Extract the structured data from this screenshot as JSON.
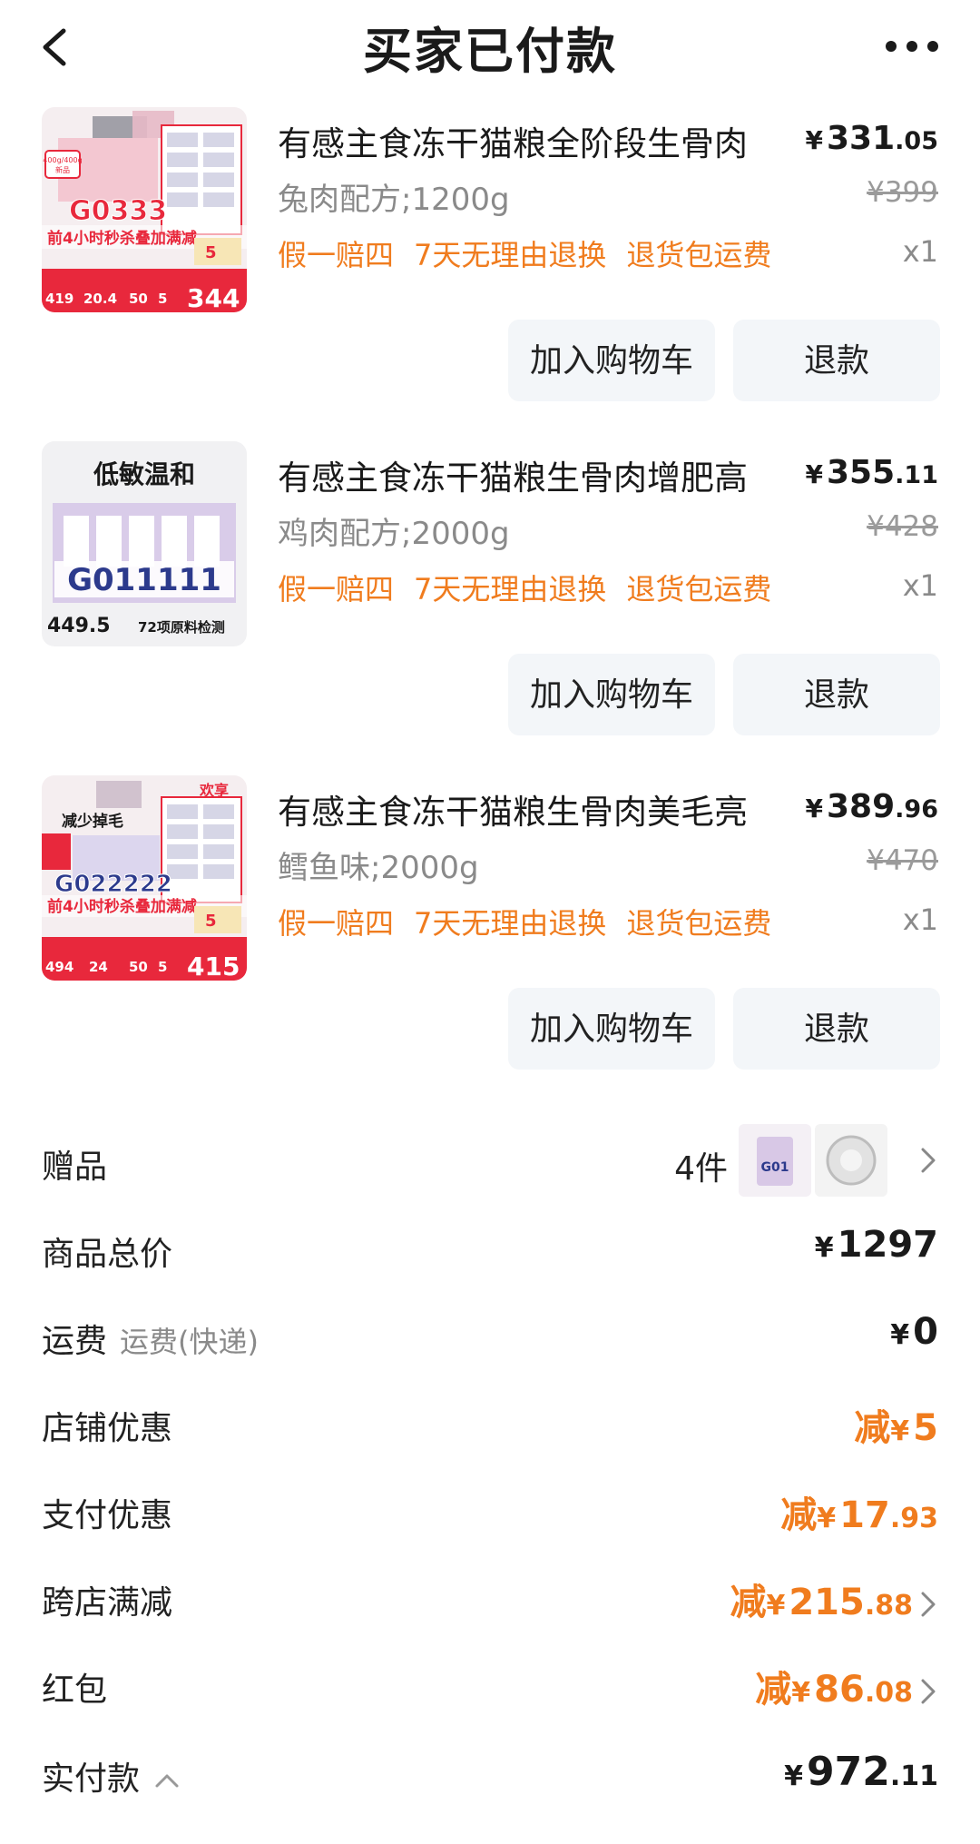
{
  "header": {
    "title": "买家已付款",
    "back_icon": "chevron-left-icon",
    "more_icon": "more-dots-icon"
  },
  "items": [
    {
      "name": "有感主食冻干猫粮全阶段生骨肉",
      "price_currency": "¥",
      "price_int": "331",
      "price_dec": ".05",
      "spec": "兔肉配方;1200g",
      "original_price": "¥399",
      "tags": [
        "假一赔四",
        "7天无理由退换",
        "退货包运费"
      ],
      "qty": "x1",
      "cart_label": "加入购物车",
      "refund_label": "退款",
      "thumb": {
        "code": "G0333",
        "banner": "前4小时秒杀叠加满减",
        "stickers": [
          "400g/400g",
          "新品"
        ],
        "chips": [
          "419",
          "20.4",
          "50",
          "5"
        ],
        "final": "344",
        "badge": "5"
      }
    },
    {
      "name": "有感主食冻干猫粮生骨肉增肥高",
      "price_currency": "¥",
      "price_int": "355",
      "price_dec": ".11",
      "spec": "鸡肉配方;2000g",
      "original_price": "¥428",
      "tags": [
        "假一赔四",
        "7天无理由退换",
        "退货包运费"
      ],
      "qty": "x1",
      "cart_label": "加入购物车",
      "refund_label": "退款",
      "thumb": {
        "heading": "低敏温和",
        "code": "G011111",
        "price": "449.5",
        "note": "72项原料检测"
      }
    },
    {
      "name": "有感主食冻干猫粮生骨肉美毛亮",
      "price_currency": "¥",
      "price_int": "389",
      "price_dec": ".96",
      "spec": "鳕鱼味;2000g",
      "original_price": "¥470",
      "tags": [
        "假一赔四",
        "7天无理由退换",
        "退货包运费"
      ],
      "qty": "x1",
      "cart_label": "加入购物车",
      "refund_label": "退款",
      "thumb": {
        "corner": "欢享",
        "heading": "减少掉毛",
        "code": "G022222",
        "banner": "前4小时秒杀叠加满减",
        "chips": [
          "494",
          "24",
          "50",
          "5"
        ],
        "final": "415",
        "badge": "5"
      }
    }
  ],
  "summary": {
    "gift": {
      "label": "赠品",
      "count": "4件",
      "gift1_text": "G01"
    },
    "subtotal": {
      "label": "商品总价",
      "cur": "¥",
      "int": "1297",
      "dec": ""
    },
    "shipping": {
      "label": "运费",
      "sub": "运费(快递)",
      "cur": "¥",
      "int": "0",
      "dec": ""
    },
    "store_discount": {
      "label": "店铺优惠",
      "prefix": "减",
      "cur": "¥",
      "int": "5",
      "dec": ""
    },
    "payment_discount": {
      "label": "支付优惠",
      "prefix": "减",
      "cur": "¥",
      "int": "17",
      "dec": ".93"
    },
    "cross_store": {
      "label": "跨店满减",
      "prefix": "减",
      "cur": "¥",
      "int": "215",
      "dec": ".88"
    },
    "red_packet": {
      "label": "红包",
      "prefix": "减",
      "cur": "¥",
      "int": "86",
      "dec": ".08"
    },
    "paid": {
      "label": "实付款",
      "cur": "¥",
      "int": "972",
      "dec": ".11"
    }
  },
  "colors": {
    "accent_orange": "#f07c1e",
    "thumb_red": "#e8283c",
    "button_bg": "#f3f6f9",
    "muted_text": "#8a8a8a"
  }
}
